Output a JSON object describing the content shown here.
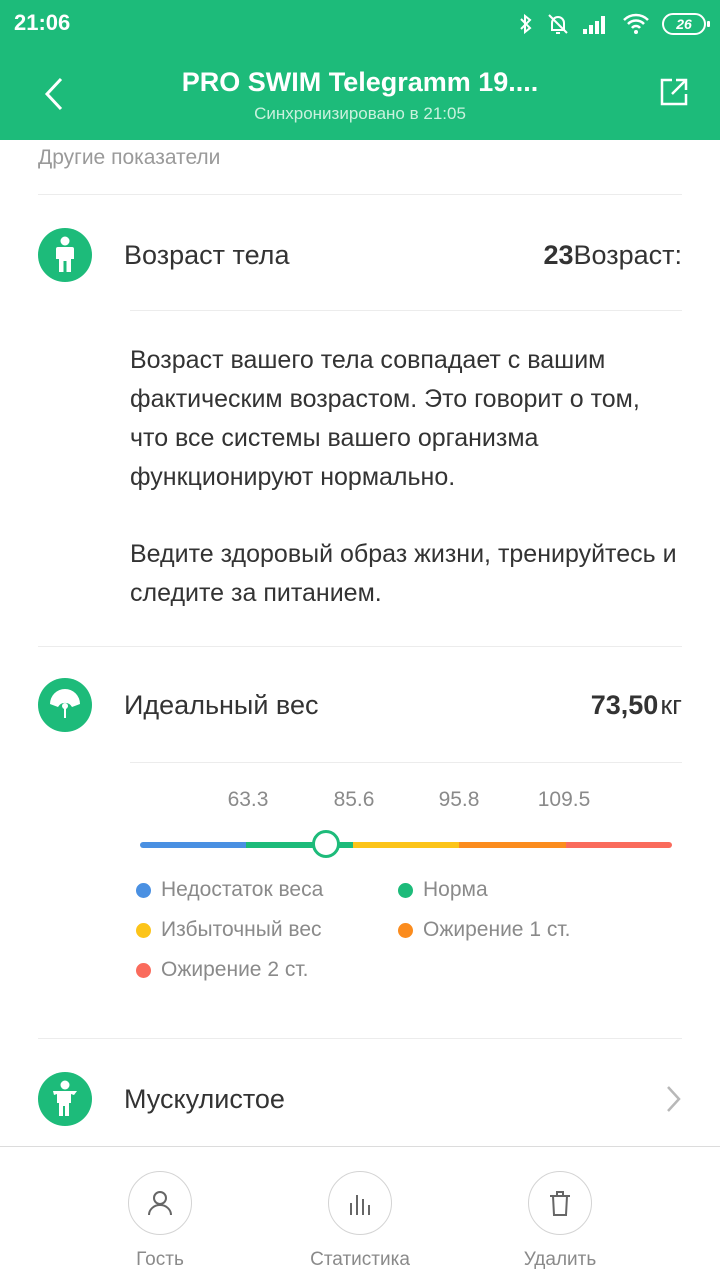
{
  "status_bar": {
    "time": "21:06",
    "battery": "26",
    "icons": [
      "bluetooth-icon",
      "alarm-off-icon",
      "signal-icon",
      "wifi-icon",
      "battery-icon"
    ]
  },
  "header": {
    "title": "PRO SWIM Telegramm 19....",
    "subtitle": "Синхронизировано в 21:05",
    "back_icon": "chevron-left-icon",
    "share_icon": "share-icon",
    "background_color": "#1dbb7a"
  },
  "section_label": "Другие показатели",
  "body_age": {
    "label": "Возраст тела",
    "value": "23",
    "value_suffix": "Возраст:",
    "icon": "person-icon",
    "description_1": "Возраст вашего тела совпадает с вашим фактическим возрастом. Это говорит о том, что все системы вашего организма функционируют нормально.",
    "description_2": "Ведите здоровый образ жизни, тренируйтесь и следите за питанием."
  },
  "ideal_weight": {
    "label": "Идеальный вес",
    "value": "73,50",
    "unit": "кг",
    "icon": "scale-icon",
    "ticks": [
      "63.3",
      "85.6",
      "95.8",
      "109.5"
    ],
    "marker_segment_fraction": 0.35,
    "segment_colors": [
      "#4a90e2",
      "#1dbb7a",
      "#fcc419",
      "#fb8c1e",
      "#fa6b5c"
    ],
    "legend": [
      {
        "label": "Недостаток веса",
        "color": "#4a90e2"
      },
      {
        "label": "Норма",
        "color": "#1dbb7a"
      },
      {
        "label": "Избыточный вес",
        "color": "#fcc419"
      },
      {
        "label": "Ожирение 1 ст.",
        "color": "#fb8c1e"
      },
      {
        "label": "Ожирение 2 ст.",
        "color": "#fa6b5c"
      }
    ]
  },
  "muscular": {
    "label": "Мускулистое",
    "icon": "muscular-person-icon"
  },
  "bottom_bar": {
    "guest": {
      "label": "Гость",
      "icon": "user-icon"
    },
    "stats": {
      "label": "Статистика",
      "icon": "bar-chart-icon"
    },
    "delete": {
      "label": "Удалить",
      "icon": "trash-icon"
    }
  }
}
